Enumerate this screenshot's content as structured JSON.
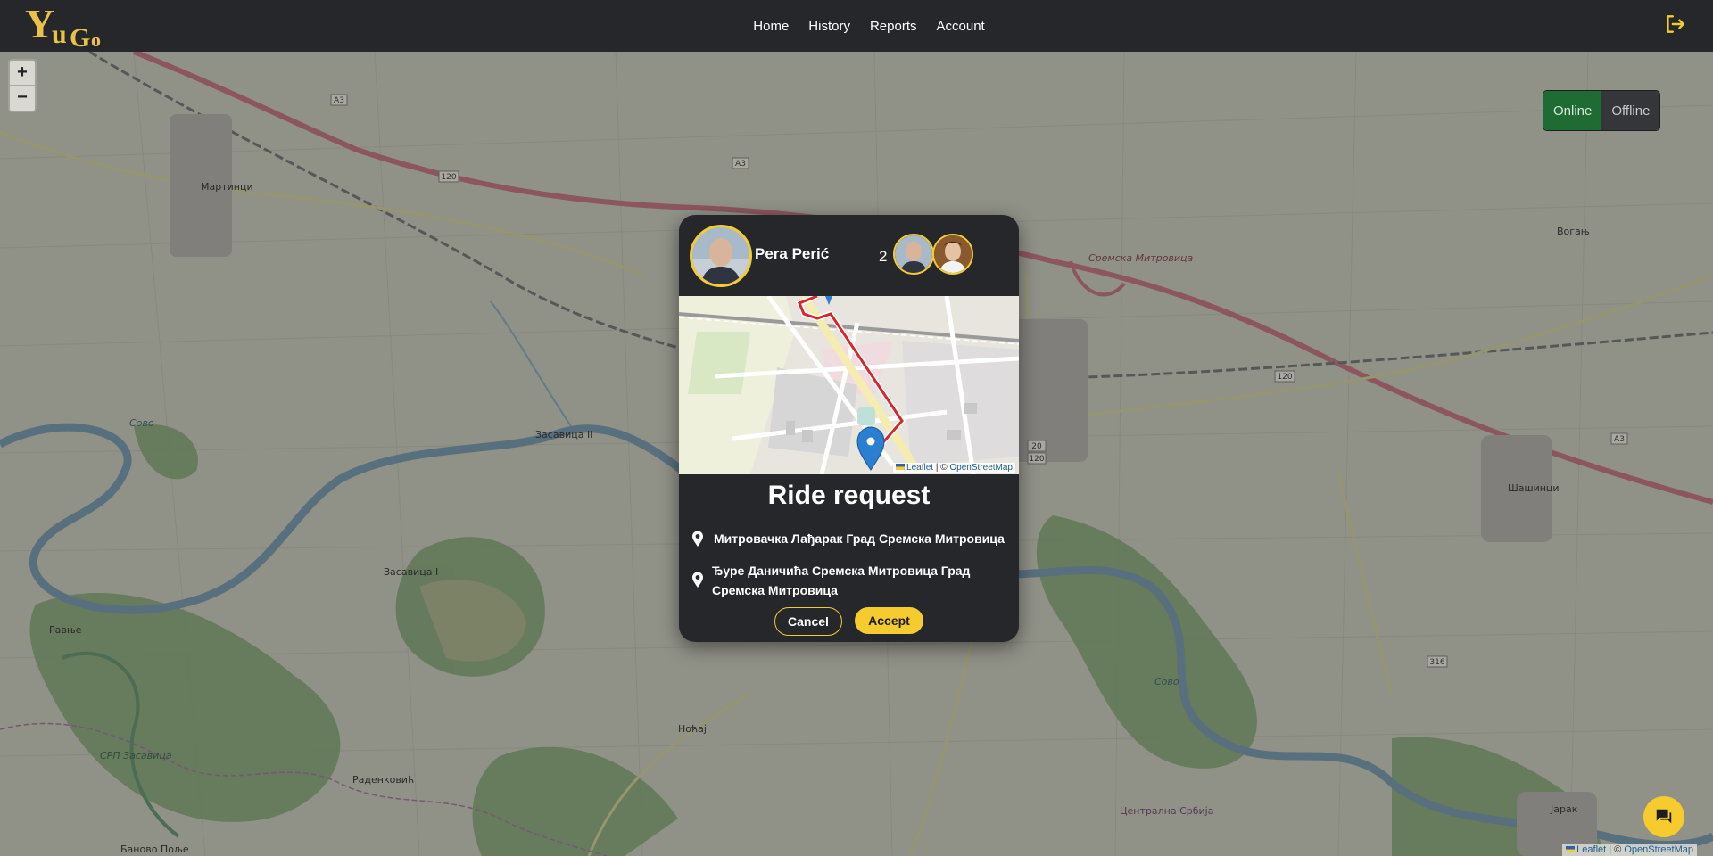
{
  "nav": {
    "brand": "YuGo",
    "links": [
      "Home",
      "History",
      "Reports",
      "Account"
    ]
  },
  "map": {
    "zoom_in": "+",
    "zoom_out": "−",
    "labels": [
      "Мартинци",
      "Засавица II",
      "Засавица I",
      "Равње",
      "Раденковић",
      "Ноћај",
      "Шашинци",
      "Вогањ",
      "Јарак",
      "Баново Поље",
      "Сремска Митровица",
      "Централна Србија",
      "СРП Засавица",
      "Сово",
      "Сово"
    ],
    "road_labels": [
      "A3",
      "A3",
      "120",
      "120",
      "A3",
      "316",
      "20",
      "120"
    ],
    "attribution_leaflet": "Leaflet",
    "attribution_sep": " | © ",
    "attribution_osm": "OpenStreetMap"
  },
  "status": {
    "online": "Online",
    "offline": "Offline",
    "active": "online"
  },
  "ride": {
    "driver_name": "Pera Perić",
    "passenger_count": "2",
    "title": "Ride request",
    "pickup": "Митровачка Лађарак Град Сремска Митровица",
    "destination": "Ђуре Даничића Сремска Митровица Град Сремска Митровица",
    "cancel_label": "Cancel",
    "accept_label": "Accept",
    "mini_attr_leaflet": "Leaflet",
    "mini_attr_sep": " | © ",
    "mini_attr_osm": "OpenStreetMap"
  },
  "colors": {
    "accent": "#f6cb2e",
    "navbar": "#26272b",
    "online": "#1e6b34",
    "offline": "#35363a",
    "route": "#d8262c"
  },
  "icons": {
    "logout": "logout-icon",
    "chat": "chat-icon",
    "pin": "map-pin-icon"
  }
}
